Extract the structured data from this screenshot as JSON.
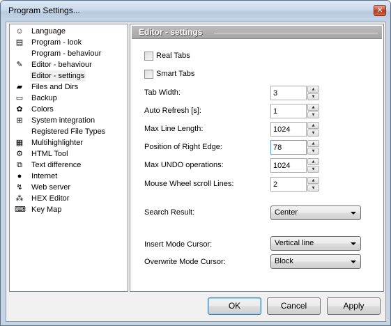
{
  "window": {
    "title": "Program Settings...",
    "close_glyph": "✕"
  },
  "tree": {
    "items": [
      {
        "label": "Language",
        "icon": "language-icon",
        "glyph": "☺",
        "selected": false
      },
      {
        "label": "Program - look",
        "icon": "window-icon",
        "glyph": "▤",
        "selected": false
      },
      {
        "label": "Program - behaviour",
        "icon": "",
        "glyph": "",
        "selected": false
      },
      {
        "label": "Editor - behaviour",
        "icon": "editor-icon",
        "glyph": "✎",
        "selected": false
      },
      {
        "label": "Editor - settings",
        "icon": "",
        "glyph": "",
        "selected": true
      },
      {
        "label": "Files and Dirs",
        "icon": "folder-icon",
        "glyph": "▰",
        "selected": false
      },
      {
        "label": "Backup",
        "icon": "backup-icon",
        "glyph": "▭",
        "selected": false
      },
      {
        "label": "Colors",
        "icon": "palette-icon",
        "glyph": "✿",
        "selected": false
      },
      {
        "label": "System integration",
        "icon": "windows-logo-icon",
        "glyph": "⊞",
        "selected": false
      },
      {
        "label": "Registered File Types",
        "icon": "",
        "glyph": "",
        "selected": false
      },
      {
        "label": "Multihighlighter",
        "icon": "highlighter-icon",
        "glyph": "▦",
        "selected": false
      },
      {
        "label": "HTML Tool",
        "icon": "gears-icon",
        "glyph": "⚙",
        "selected": false
      },
      {
        "label": "Text difference",
        "icon": "compare-icon",
        "glyph": "⧉",
        "selected": false
      },
      {
        "label": "Internet",
        "icon": "globe-icon",
        "glyph": "●",
        "selected": false
      },
      {
        "label": "Web server",
        "icon": "server-icon",
        "glyph": "↯",
        "selected": false
      },
      {
        "label": "HEX Editor",
        "icon": "hex-icon",
        "glyph": "⁂",
        "selected": false
      },
      {
        "label": "Key Map",
        "icon": "keyboard-icon",
        "glyph": "⌨",
        "selected": false
      }
    ]
  },
  "panel": {
    "title": "Editor - settings",
    "real_tabs": {
      "label": "Real Tabs",
      "checked": false
    },
    "smart_tabs": {
      "label": "Smart Tabs",
      "checked": false
    },
    "tab_width": {
      "label": "Tab Width:",
      "value": "3"
    },
    "auto_refresh": {
      "label": "Auto Refresh [s]:",
      "value": "1"
    },
    "max_line_length": {
      "label": "Max Line Length:",
      "value": "1024"
    },
    "right_edge": {
      "label": "Position of Right Edge:",
      "value": "78"
    },
    "max_undo": {
      "label": "Max UNDO operations:",
      "value": "1024"
    },
    "wheel_lines": {
      "label": "Mouse Wheel scroll Lines:",
      "value": "2"
    },
    "search_result": {
      "label": "Search Result:",
      "value": "Center"
    },
    "insert_cursor": {
      "label": "Insert Mode Cursor:",
      "value": "Vertical line"
    },
    "overwrite_cursor": {
      "label": "Overwrite Mode Cursor:",
      "value": "Block"
    },
    "spin_up_glyph": "▲",
    "spin_down_glyph": "▼"
  },
  "buttons": {
    "ok": "OK",
    "cancel": "Cancel",
    "apply": "Apply"
  }
}
